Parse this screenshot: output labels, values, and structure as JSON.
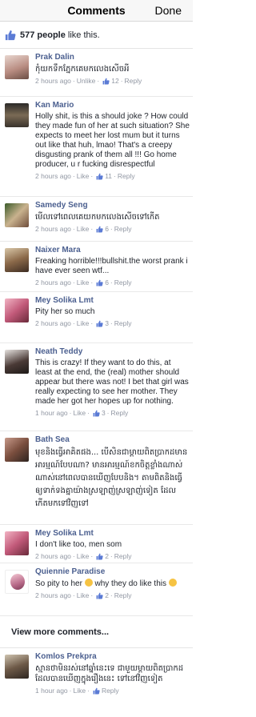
{
  "nav": {
    "title": "Comments",
    "done": "Done"
  },
  "likes": {
    "count": "577 people",
    "suffix": " like this."
  },
  "comments": [
    {
      "name": "Prak Dalin",
      "text": "កុំយកទឹកភ្នែកគេមកលេងសើចអី",
      "time": "2 hours ago",
      "action": "Unlike",
      "likes": "12",
      "reply": "Reply",
      "khmer": true
    },
    {
      "name": "Kan Mario",
      "text": "Holly shit, is this a should joke ? How could they made fun of her at such situation? She expects to meet her lost mum but it turns out like that huh, lmao! That's a  creepy disgusting prank of them all !!! Go home producer, u r fucking disrespectful",
      "time": "2 hours ago",
      "action": "Like",
      "likes": "11",
      "reply": "Reply"
    },
    {
      "name": "Samedy Seng",
      "text": "មើលទៅពេលគេយកមកលេងសើចទៅកើត",
      "time": "2 hours ago",
      "action": "Like",
      "likes": "6",
      "reply": "Reply",
      "khmer": true
    },
    {
      "name": "Naixer Mara",
      "text": "Freaking horrible!!!bullshit.the worst prank i have ever seen wtf...",
      "time": "2 hours ago",
      "action": "Like",
      "likes": "6",
      "reply": "Reply"
    },
    {
      "name": "Mey Solika Lmt",
      "text": "Pity her so much",
      "time": "2 hours ago",
      "action": "Like",
      "likes": "3",
      "reply": "Reply"
    },
    {
      "name": "Neath Teddy",
      "text": "This is crazy! If they want to do this, at least at the end, the (real) mother should appear but there was not! I bet that girl was really expecting to see her mother. They made her got her hopes up for nothing.",
      "time": "1 hour ago",
      "action": "Like",
      "likes": "3",
      "reply": "Reply"
    },
    {
      "name": "Bath Sea",
      "text": "មុខនិងធ្វើអាគិតផង... បើសិនជាម្តាយពិតប្រាកដមានអារម្មណ៍បែបណា? មានអារម្មណ៍ខកចិត្តខ្លាំងណាស់ណាស់នៅពេលបានឃើញបែបនិង។ តាមពិតនិងធ្វើឲ្យទាក់ទងគ្នាយ៉ាងស្រឡាញ់ស្រឡាញ់ទៀត ដែលកើតមកទៅវិញទៅ",
      "time": "",
      "action": "",
      "likes": "",
      "reply": "",
      "khmer": true
    },
    {
      "name": "Mey Solika Lmt",
      "text": "I don't like too, men som",
      "time": "2 hours ago",
      "action": "Like",
      "likes": "2",
      "reply": "Reply"
    },
    {
      "name": "Quiennie Paradise",
      "text": "So pity to her",
      "text2": "why they do like this",
      "time": "2 hours ago",
      "action": "Like",
      "likes": "2",
      "reply": "Reply"
    },
    {
      "name": "Komlos Prekpra",
      "text": "ស្មានថាមិនរស់នៅឆ្នាំនេះទេ ជាមួយម្តាយពិតប្រាកដ ដែលបានឃើញក្នុងរឿងនេះ ទៅនៅវិញទៀត",
      "time": "1 hour ago",
      "action": "Like",
      "likes": "",
      "reply": "Reply",
      "khmer": true
    }
  ],
  "view_more": "View more comments...",
  "colors": {
    "name": "#4b5f8f",
    "meta": "#9197a3",
    "like_blue": "#5b7bd5"
  }
}
